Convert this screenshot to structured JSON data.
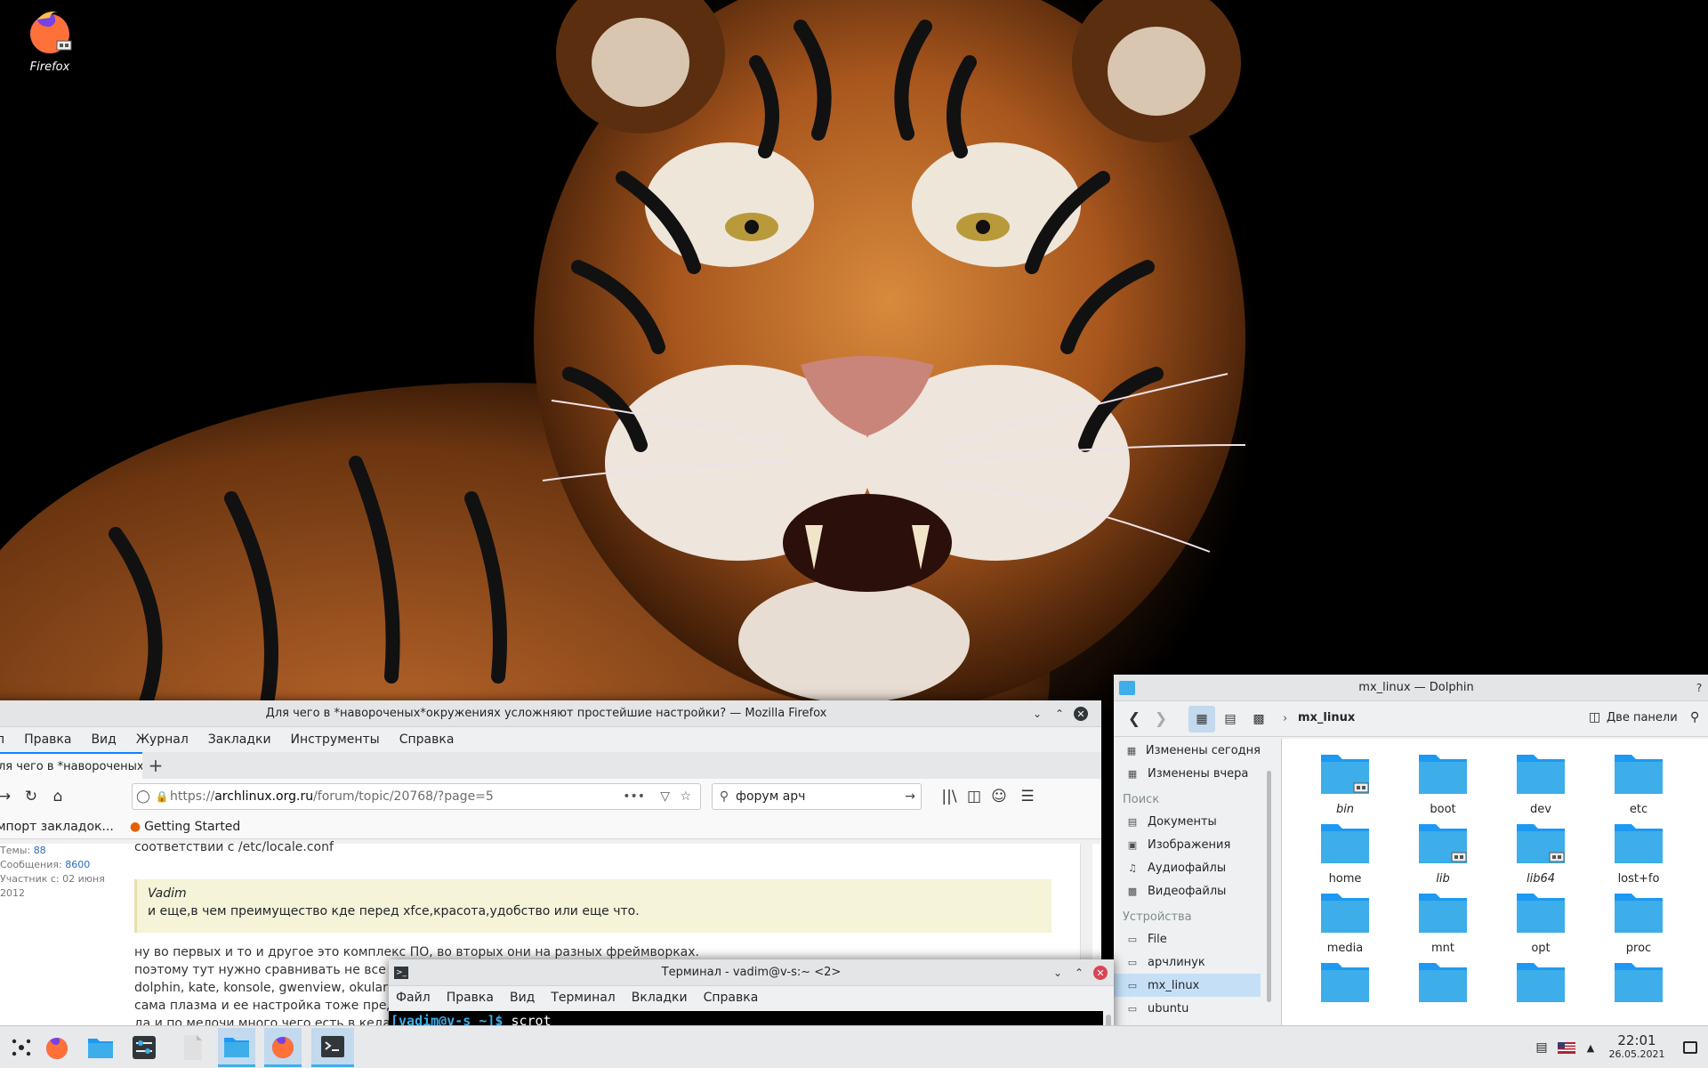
{
  "desktop": {
    "icon_label": "Firefox"
  },
  "firefox": {
    "title": "Для чего в *навороченых*окружениях усложняют простейшие настройки? — Mozilla Firefox",
    "menu": [
      "п",
      "Правка",
      "Вид",
      "Журнал",
      "Закладки",
      "Инструменты",
      "Справка"
    ],
    "tab_title": "ля чего в *навороченых",
    "url_scheme": "https://",
    "url_host": "archlinux.org.ru",
    "url_path": "/forum/topic/20768/?page=5",
    "search_value": "форум арч",
    "bookmarks": [
      "мпорт закладок...",
      "Getting Started"
    ],
    "profile": {
      "topics_label": "Темы:",
      "topics": "88",
      "posts_label": "Сообщения:",
      "posts": "8600",
      "member_since": "Участник с: 02 июня",
      "member_year": "2012"
    },
    "post": {
      "line0": "соответствии с /etc/locale.conf",
      "quote_author": "Vadim",
      "quote_text": "и еще,в чем преимущество кде перед xfce,красота,удобство или еще что.",
      "line1": "ну во первых и то и другое это комплекс ПО, во вторых они на разных фреймворках.",
      "line2": "поэтому тут нужно сравнивать не все вку",
      "line3": "dolphin, kate, konsole, gwenview, okular, я с",
      "line4": "сама плазма и ее настройка тоже предост",
      "line5": "да и по мелочи много чего есть в кедах ч"
    }
  },
  "dolphin": {
    "title": "mx_linux — Dolphin",
    "breadcrumb": "mx_linux",
    "split_label": "Две панели",
    "places": [
      {
        "label": "Изменены сегодня",
        "icon": "calendar-icon"
      },
      {
        "label": "Изменены вчера",
        "icon": "calendar-icon"
      }
    ],
    "search_header": "Поиск",
    "search_items": [
      {
        "label": "Документы",
        "icon": "document-icon"
      },
      {
        "label": "Изображения",
        "icon": "image-icon"
      },
      {
        "label": "Аудиофайлы",
        "icon": "music-icon"
      },
      {
        "label": "Видеофайлы",
        "icon": "video-icon"
      }
    ],
    "devices_header": "Устройства",
    "devices": [
      {
        "label": "File",
        "icon": "drive-icon"
      },
      {
        "label": "арчлинук",
        "icon": "drive-icon"
      },
      {
        "label": "mx_linux",
        "icon": "drive-icon",
        "selected": true
      },
      {
        "label": "ubuntu",
        "icon": "drive-icon"
      }
    ],
    "folders": [
      {
        "name": "bin",
        "link": true
      },
      {
        "name": "boot",
        "link": false
      },
      {
        "name": "dev",
        "link": false
      },
      {
        "name": "etc",
        "link": false
      },
      {
        "name": "home",
        "link": false
      },
      {
        "name": "lib",
        "link": true
      },
      {
        "name": "lib64",
        "link": true
      },
      {
        "name": "lost+fo",
        "link": false
      },
      {
        "name": "media",
        "link": false
      },
      {
        "name": "mnt",
        "link": false
      },
      {
        "name": "opt",
        "link": false
      },
      {
        "name": "proc",
        "link": false
      }
    ]
  },
  "terminal": {
    "title": "Терминал - vadim@v-s:~ <2>",
    "menu": [
      "Файл",
      "Правка",
      "Вид",
      "Терминал",
      "Вкладки",
      "Справка"
    ],
    "prompt": "[vadim@v-s ~]$",
    "command": " scrot"
  },
  "taskbar": {
    "time": "22:01",
    "date": "26.05.2021"
  },
  "colors": {
    "accent": "#3daee9",
    "folder": "#3daee9",
    "selection": "#c5dff6",
    "close_red": "#da4453"
  }
}
